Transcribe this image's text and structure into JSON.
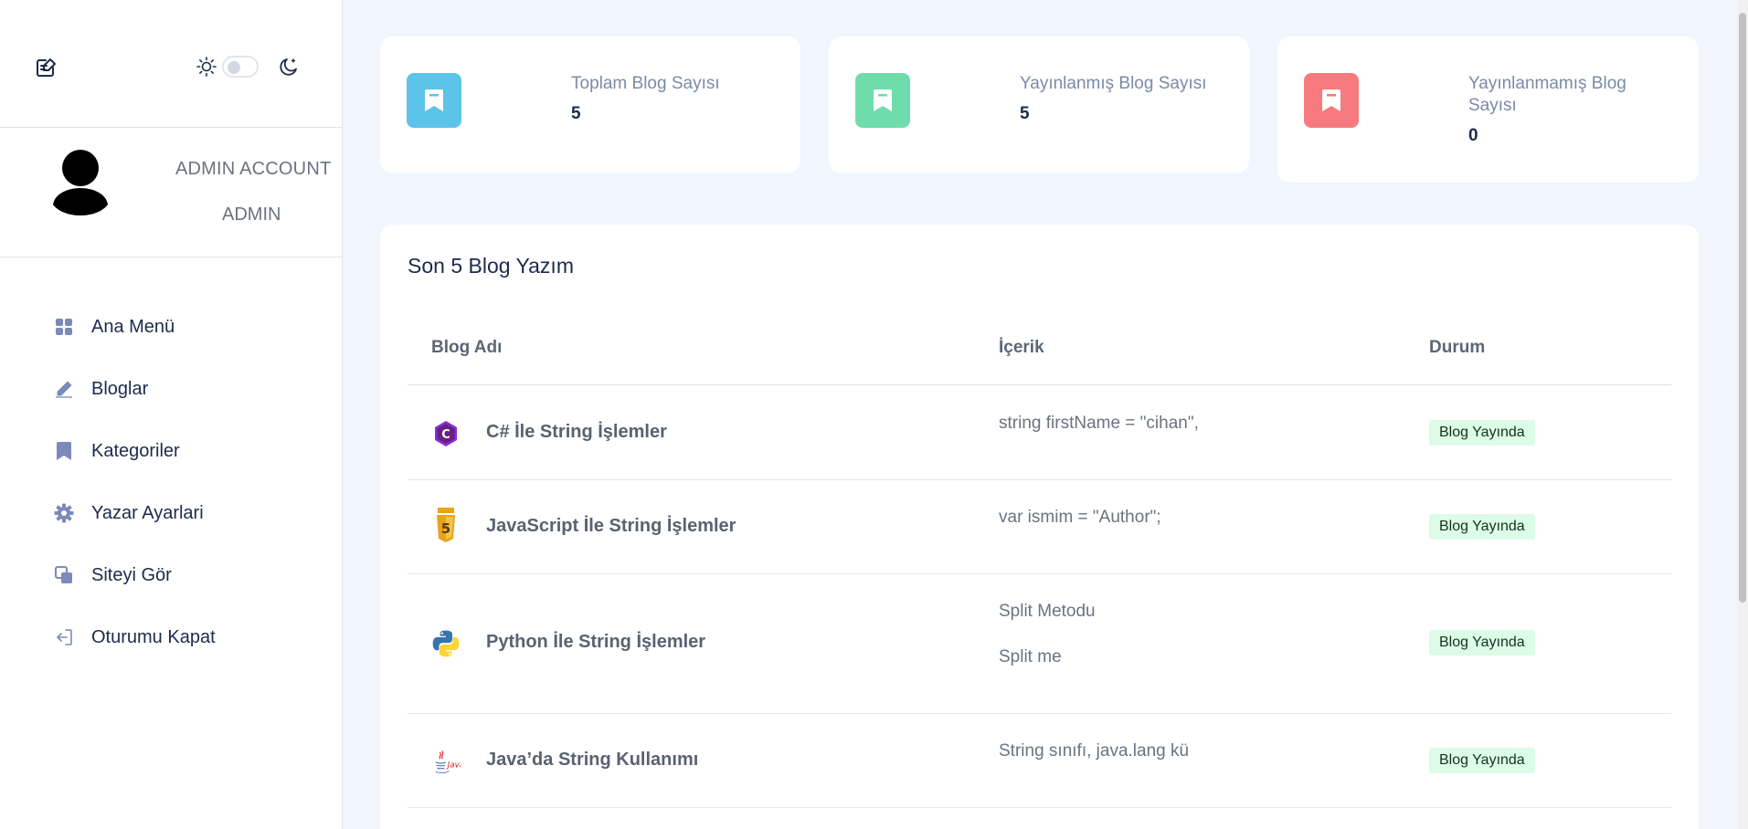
{
  "sidebar": {
    "theme": {
      "light_icon": "sun-icon",
      "dark_icon": "moon-icon",
      "dark_mode": false
    },
    "profile": {
      "name": "ADMIN ACCOUNT",
      "role": "ADMIN"
    },
    "nav": [
      {
        "label": "Ana Menü",
        "icon": "grid-icon"
      },
      {
        "label": "Bloglar",
        "icon": "pencil-icon"
      },
      {
        "label": "Kategoriler",
        "icon": "bookmark-icon"
      },
      {
        "label": "Yazar Ayarlari",
        "icon": "gear-icon"
      },
      {
        "label": "Siteyi Gör",
        "icon": "copy-icon"
      },
      {
        "label": "Oturumu Kapat",
        "icon": "logout-icon"
      }
    ]
  },
  "stats": [
    {
      "title": "Toplam Blog Sayısı",
      "value": "5",
      "color": "#5bc4e8"
    },
    {
      "title": "Yayınlanmış Blog Sayısı",
      "value": "5",
      "color": "#6fdcac"
    },
    {
      "title": "Yayınlanmamış Blog Sayısı",
      "value": "0",
      "color": "#f67a7e"
    }
  ],
  "recent": {
    "title": "Son 5 Blog Yazım",
    "columns": {
      "name": "Blog Adı",
      "content": "İçerik",
      "status": "Durum"
    },
    "rows": [
      {
        "name": "C# İle String İşlemler",
        "content": [
          "string firstName = \"cihan\","
        ],
        "status": "Blog Yayında",
        "logo": "csharp-icon"
      },
      {
        "name": "JavaScript İle String İşlemler",
        "content": [
          "var ismim = \"Author\";"
        ],
        "status": "Blog Yayında",
        "logo": "html5-icon"
      },
      {
        "name": "Python İle String İşlemler",
        "content": [
          "Split Metodu",
          "Split me"
        ],
        "status": "Blog Yayında",
        "logo": "python-icon"
      },
      {
        "name": "Java’da String Kullanımı",
        "content": [
          "String sınıfı, java.lang kü"
        ],
        "status": "Blog Yayında",
        "logo": "java-icon",
        "logo_text": "Java"
      }
    ]
  }
}
